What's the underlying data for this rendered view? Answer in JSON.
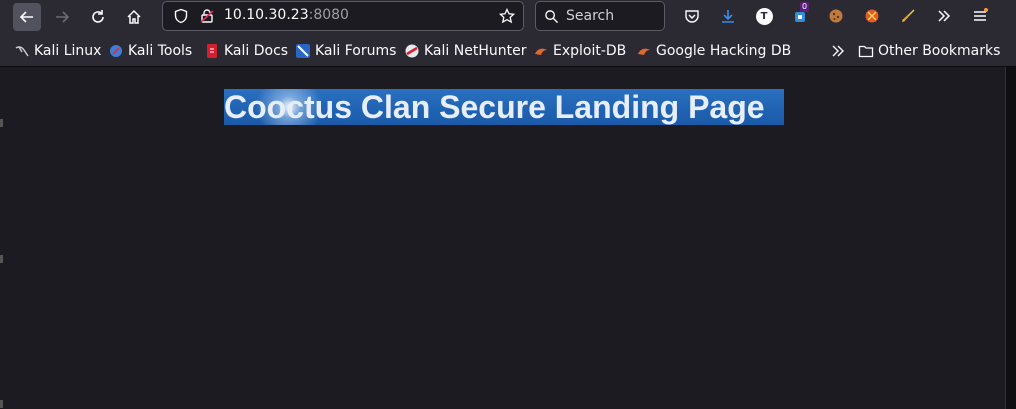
{
  "browser": {
    "url_host": "10.10.30.23",
    "url_port": ":8080",
    "search_placeholder": "Search",
    "extension_badge": "0",
    "avatar_letter": "T"
  },
  "bookmarks": [
    {
      "label": "Kali Linux",
      "icon": "kali-dragon-icon"
    },
    {
      "label": "Kali Tools",
      "icon": "kali-tools-icon"
    },
    {
      "label": "Kali Docs",
      "icon": "kali-docs-icon"
    },
    {
      "label": "Kali Forums",
      "icon": "kali-forums-icon"
    },
    {
      "label": "Kali NetHunter",
      "icon": "nethunter-icon"
    },
    {
      "label": "Exploit-DB",
      "icon": "exploit-db-icon"
    },
    {
      "label": "Google Hacking DB",
      "icon": "ghdb-icon"
    }
  ],
  "other_bookmarks": "Other Bookmarks",
  "page": {
    "heading": "Cooctus Clan Secure Landing Page"
  },
  "colors": {
    "toolbar": "#2b2a33",
    "content_bg": "#1c1b22",
    "banner_blue": "#2a6fc0"
  }
}
